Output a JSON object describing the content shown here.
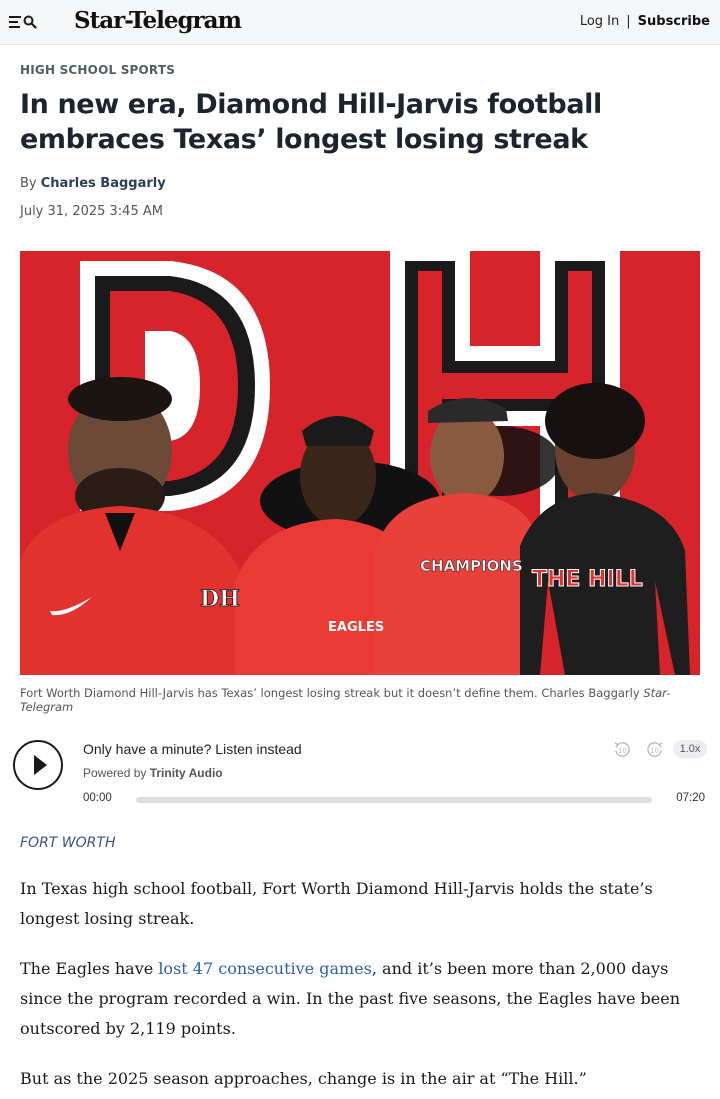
{
  "header": {
    "logo": "Star-Telegram",
    "login_label": "Log In",
    "separator": "|",
    "subscribe_label": "Subscribe"
  },
  "article": {
    "section": "HIGH SCHOOL SPORTS",
    "headline": "In new era, Diamond Hill-Jarvis football embraces Texas’ longest losing streak",
    "byline_prefix": "By",
    "author": "Charles Baggarly",
    "date": "July 31, 2025 3:45 AM",
    "photo_alt": "Four Diamond Hill-Jarvis football players posing in front of a red DH logo wall",
    "caption_text": "Fort Worth Diamond Hill-Jarvis has Texas’ longest losing streak but it doesn’t define them. Charles Baggarly",
    "caption_credit": "Star-Telegram",
    "photo_wall_text": "DH",
    "shirt_text_1": "EAGLES",
    "shirt_text_2": "CHAMPIONS",
    "shirt_text_3": "THE HILL"
  },
  "audio": {
    "title": "Only have a minute? Listen instead",
    "powered_by_prefix": "Powered by",
    "powered_by_brand": "Trinity Audio",
    "rewind_label": "10",
    "forward_label": "10",
    "speed": "1.0x",
    "current_time": "00:00",
    "total_time": "07:20",
    "progress_fraction": 0
  },
  "body": {
    "location": "FORT WORTH",
    "p1": "In Texas high school football, Fort Worth Diamond Hill-Jarvis holds the state’s longest losing streak.",
    "p2_before": "The Eagles have ",
    "p2_link": "lost 47 consecutive games",
    "p2_after": ", and it’s been more than 2,000 days since the program recorded a win. In the past five seasons, the Eagles have been outscored by 2,119 points.",
    "p3": "But as the 2025 season approaches, change is in the air at “The Hill.”"
  },
  "colors": {
    "wall_red": "#d6242a",
    "link_blue": "#2d5ea8",
    "headline": "#1c2430"
  }
}
